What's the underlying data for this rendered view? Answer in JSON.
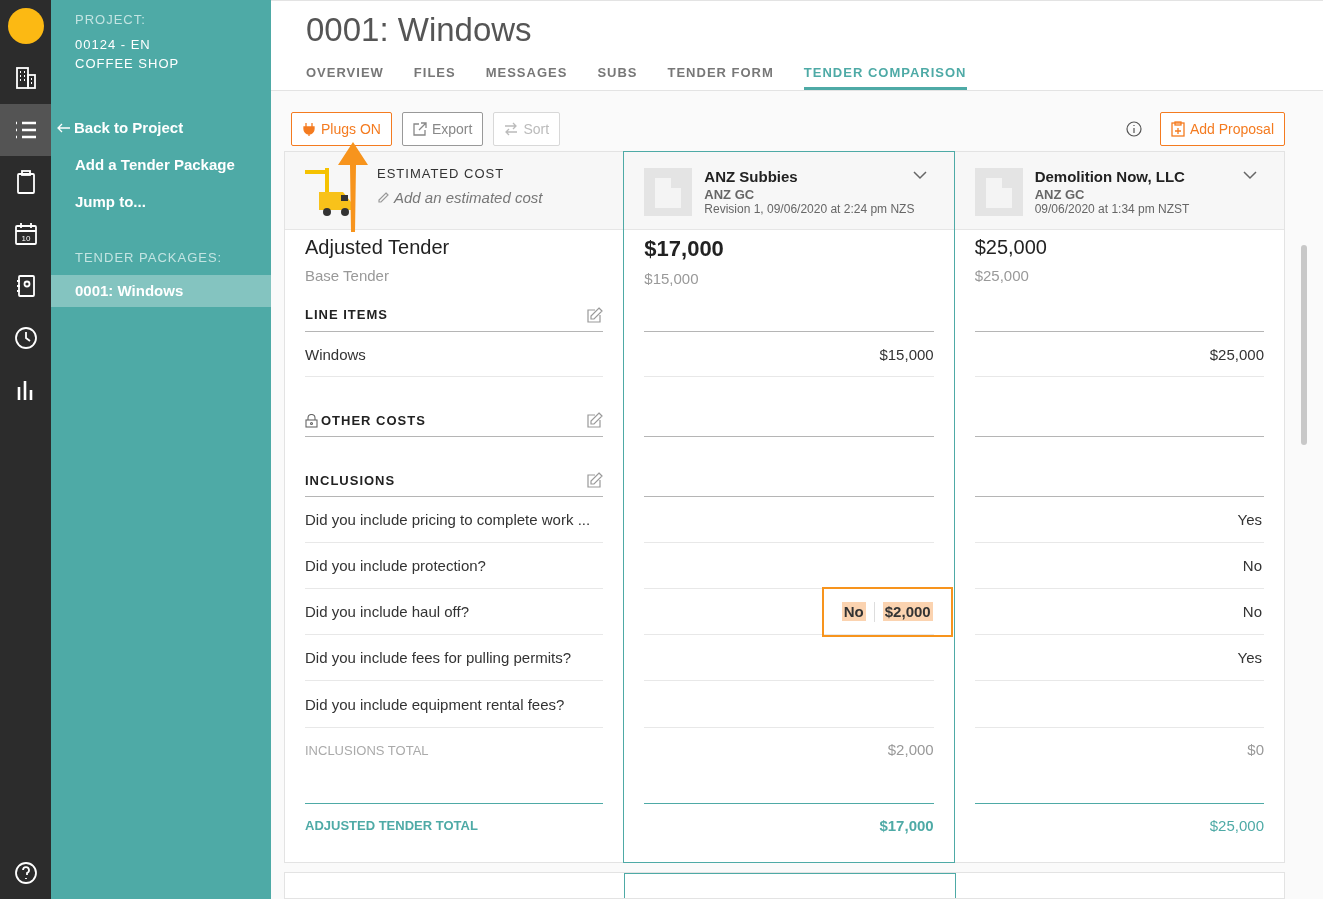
{
  "rail": {
    "items": [
      {
        "selected": false
      },
      {
        "selected": false
      },
      {
        "selected": true
      },
      {
        "selected": false
      },
      {
        "badge": "10",
        "selected": false
      },
      {
        "selected": false
      },
      {
        "selected": false
      },
      {
        "selected": false
      }
    ]
  },
  "sidebar": {
    "project_label": "PROJECT:",
    "project_lines": [
      "00124 - EN",
      "COFFEE SHOP"
    ],
    "back_link": "Back to Project",
    "links": [
      "Add a Tender Package",
      "Jump to..."
    ],
    "packages_label": "TENDER PACKAGES:",
    "packages": [
      {
        "label": "0001: Windows",
        "selected": true
      }
    ]
  },
  "title": "0001: Windows",
  "tabs": [
    {
      "label": "OVERVIEW",
      "selected": false
    },
    {
      "label": "FILES",
      "selected": false
    },
    {
      "label": "MESSAGES",
      "selected": false
    },
    {
      "label": "SUBS",
      "selected": false
    },
    {
      "label": "TENDER FORM",
      "selected": false
    },
    {
      "label": "TENDER COMPARISON",
      "selected": true
    }
  ],
  "toolbar": {
    "buttons": [
      {
        "label": "Plugs ON",
        "kind": "accent"
      },
      {
        "label": "Export",
        "kind": "default"
      },
      {
        "label": "Sort",
        "kind": "disabled"
      }
    ],
    "add_proposal": "Add Proposal"
  },
  "estimate": {
    "label": "ESTIMATED COST",
    "placeholder": "Add an estimated cost"
  },
  "summary": {
    "adjusted": "Adjusted Tender",
    "base": "Base Tender"
  },
  "line_items": {
    "title": "LINE ITEMS",
    "rows": [
      "Windows"
    ]
  },
  "other_costs": {
    "title": "OTHER COSTS",
    "locked": true
  },
  "inclusions": {
    "title": "INCLUSIONS",
    "rows": [
      "Did you include pricing to complete work ...",
      "Did you include protection?",
      "Did you include haul off?",
      "Did you include fees for pulling permits?",
      "Did you include equipment rental fees?"
    ],
    "total_label": "INCLUSIONS TOTAL"
  },
  "adjusted_total_label": "ADJUSTED TENDER TOTAL",
  "bidders": [
    {
      "name": "ANZ Subbies",
      "company": "ANZ GC",
      "date": "Revision 1, 09/06/2020 at 2:24 pm NZS",
      "selected": true,
      "amount": "$17,000",
      "base": "$15,000",
      "line_items": [
        "$15,000"
      ],
      "inclusions": [
        {
          "highlighted": false
        },
        {
          "highlighted": false
        },
        {
          "answer": "No",
          "price": "$2,000",
          "highlighted": true
        },
        {
          "highlighted": false
        },
        {
          "highlighted": false
        }
      ],
      "inclusions_total": "$2,000",
      "adjusted_total": "$17,000"
    },
    {
      "name": "Demolition Now, LLC",
      "company": "ANZ GC",
      "date": "09/06/2020 at 1:34 pm NZST",
      "selected": false,
      "amount": "$25,000",
      "base": "$25,000",
      "line_items": [
        "$25,000"
      ],
      "inclusions": [
        {
          "answer": "Yes",
          "highlighted": false
        },
        {
          "answer": "No",
          "highlighted": false
        },
        {
          "answer": "No",
          "highlighted": false
        },
        {
          "answer": "Yes",
          "highlighted": false
        },
        {
          "highlighted": false
        }
      ],
      "inclusions_total": "$0",
      "adjusted_total": "$25,000"
    }
  ]
}
